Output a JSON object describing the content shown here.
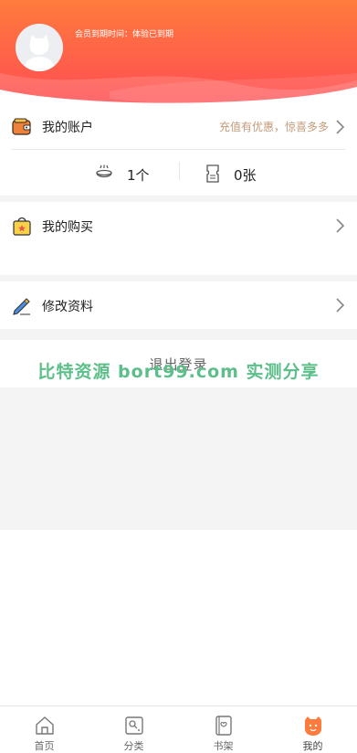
{
  "header": {
    "member_expiry_text": "会员到期时间：体验已到期",
    "gradient_top": "#ff7a3d",
    "gradient_bottom": "#ff5252"
  },
  "account": {
    "label": "我的账户",
    "promo_text": "充值有优惠，惊喜多多",
    "icon": "wallet-icon"
  },
  "assets": {
    "coins_value": "1个",
    "coins_icon": "coin-bowl-icon",
    "tickets_value": "0张",
    "tickets_icon": "ticket-icon"
  },
  "purchases": {
    "label": "我的购买",
    "icon": "shopping-bag-icon"
  },
  "profile": {
    "label": "修改资料",
    "icon": "edit-pen-icon"
  },
  "logout": {
    "label": "退出登录"
  },
  "watermark": {
    "text": "比特资源 bort99.com 实测分享"
  },
  "tabbar": {
    "tabs": [
      {
        "label": "首页",
        "icon": "home-icon",
        "active": false
      },
      {
        "label": "分类",
        "icon": "category-icon",
        "active": false
      },
      {
        "label": "书架",
        "icon": "bookshelf-icon",
        "active": false
      },
      {
        "label": "我的",
        "icon": "profile-cat-icon",
        "active": true
      }
    ]
  }
}
